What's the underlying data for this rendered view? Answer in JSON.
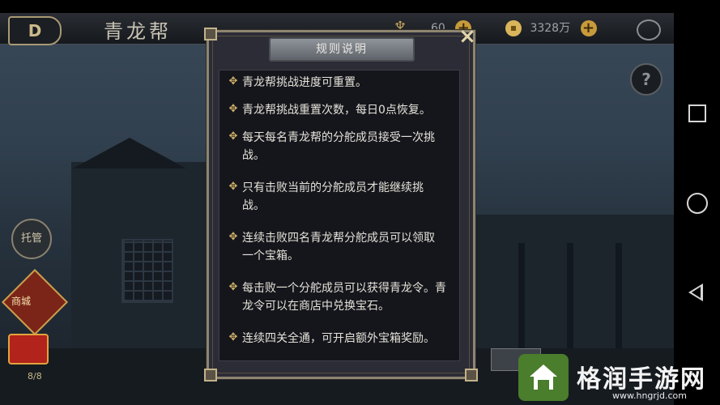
{
  "header": {
    "back_label": "D",
    "title": "青龙帮",
    "currency_1": "60",
    "currency_2": "3328万"
  },
  "side": {
    "trustee_label": "托管",
    "shop_label": "商城",
    "progress": "8/8"
  },
  "dialog": {
    "title": "规则说明",
    "close_icon": "×",
    "bullet_icon": "diamond-bullet-icon",
    "rules": [
      "青龙帮挑战进度可重置。",
      "青龙帮挑战重置次数，每日0点恢复。",
      "每天每名青龙帮的分舵成员接受一次挑战。",
      "只有击败当前的分舵成员才能继续挑战。",
      "连续击败四名青龙帮分舵成员可以领取一个宝箱。",
      "每击败一个分舵成员可以获得青龙令。青龙令可以在商店中兑换宝石。",
      "连续四关全通，可开启额外宝箱奖励。"
    ]
  },
  "help_label": "?",
  "watermark": {
    "text": "格润手游网",
    "url": "www.hngrjd.com"
  },
  "colors": {
    "accent_gold": "#c9a55a",
    "watermark_green": "#4a7d2c"
  }
}
